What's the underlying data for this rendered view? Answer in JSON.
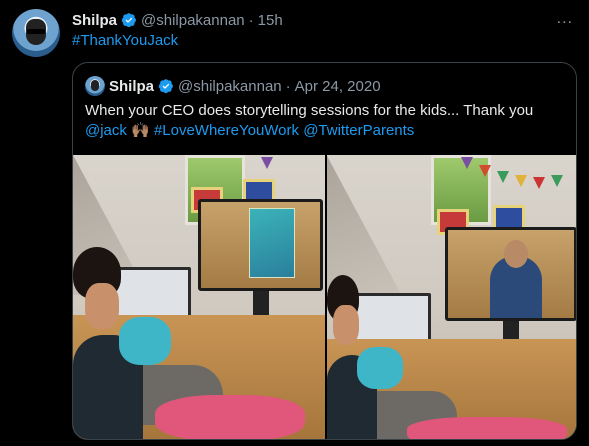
{
  "tweet": {
    "author_name": "Shilpa",
    "handle": "@shilpakannan",
    "separator": "·",
    "time": "15h",
    "text": "#ThankYouJack",
    "more_icon": "..."
  },
  "quoted": {
    "author_name": "Shilpa",
    "handle": "@shilpakannan",
    "separator": "·",
    "date": "Apr 24, 2020",
    "text_line1": "When your CEO does storytelling sessions for the kids... Thank you",
    "mention": "@jack",
    "emoji": "🙌🏽",
    "hashtag": "#LoveWhereYouWork",
    "mention2": "@TwitterParents",
    "photos": [
      "photo-1",
      "photo-2"
    ]
  },
  "colors": {
    "link": "#1d9bf0",
    "secondary": "#8b98a5",
    "verified": "#1d9bf0",
    "background": "#000000"
  },
  "icons": {
    "verified": "verified-badge-icon",
    "more": "more-options-icon"
  }
}
